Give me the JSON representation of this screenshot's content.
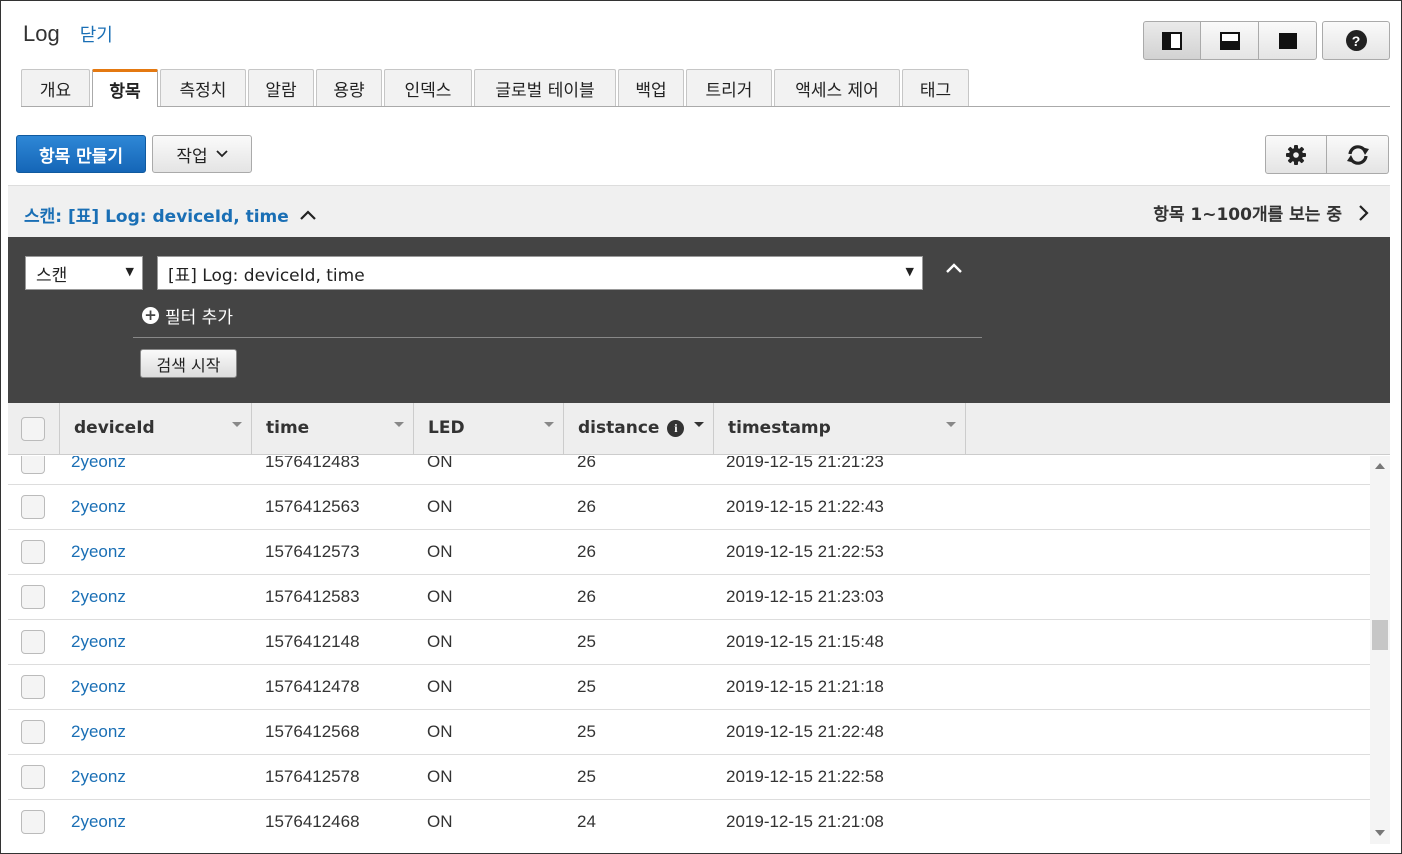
{
  "header": {
    "title": "Log",
    "close_label": "닫기"
  },
  "tabs": [
    {
      "label": "개요",
      "active": false
    },
    {
      "label": "항목",
      "active": true
    },
    {
      "label": "측정치",
      "active": false
    },
    {
      "label": "알람",
      "active": false
    },
    {
      "label": "용량",
      "active": false
    },
    {
      "label": "인덱스",
      "active": false
    },
    {
      "label": "글로벌 테이블",
      "active": false
    },
    {
      "label": "백업",
      "active": false
    },
    {
      "label": "트리거",
      "active": false
    },
    {
      "label": "액세스 제어",
      "active": false
    },
    {
      "label": "태그",
      "active": false
    }
  ],
  "toolbar": {
    "create_label": "항목 만들기",
    "actions_label": "작업"
  },
  "scan": {
    "title": "스캔: [표] Log: deviceId, time",
    "count_text": "항목 1~100개를 보는 중",
    "mode_value": "스캔",
    "table_value": "[표] Log: deviceId, time",
    "add_filter_label": "필터 추가",
    "search_label": "검색 시작"
  },
  "columns": [
    "deviceId",
    "time",
    "LED",
    "distance",
    "timestamp"
  ],
  "rows": [
    {
      "deviceId": "2yeonz",
      "time": "1576412483",
      "LED": "ON",
      "distance": "26",
      "timestamp": "2019-12-15 21:21:23"
    },
    {
      "deviceId": "2yeonz",
      "time": "1576412563",
      "LED": "ON",
      "distance": "26",
      "timestamp": "2019-12-15 21:22:43"
    },
    {
      "deviceId": "2yeonz",
      "time": "1576412573",
      "LED": "ON",
      "distance": "26",
      "timestamp": "2019-12-15 21:22:53"
    },
    {
      "deviceId": "2yeonz",
      "time": "1576412583",
      "LED": "ON",
      "distance": "26",
      "timestamp": "2019-12-15 21:23:03"
    },
    {
      "deviceId": "2yeonz",
      "time": "1576412148",
      "LED": "ON",
      "distance": "25",
      "timestamp": "2019-12-15 21:15:48"
    },
    {
      "deviceId": "2yeonz",
      "time": "1576412478",
      "LED": "ON",
      "distance": "25",
      "timestamp": "2019-12-15 21:21:18"
    },
    {
      "deviceId": "2yeonz",
      "time": "1576412568",
      "LED": "ON",
      "distance": "25",
      "timestamp": "2019-12-15 21:22:48"
    },
    {
      "deviceId": "2yeonz",
      "time": "1576412578",
      "LED": "ON",
      "distance": "25",
      "timestamp": "2019-12-15 21:22:58"
    },
    {
      "deviceId": "2yeonz",
      "time": "1576412468",
      "LED": "ON",
      "distance": "24",
      "timestamp": "2019-12-15 21:21:08"
    }
  ],
  "colors": {
    "accent": "#1a6fb5",
    "active_tab": "#e47911",
    "panel": "#444444"
  }
}
